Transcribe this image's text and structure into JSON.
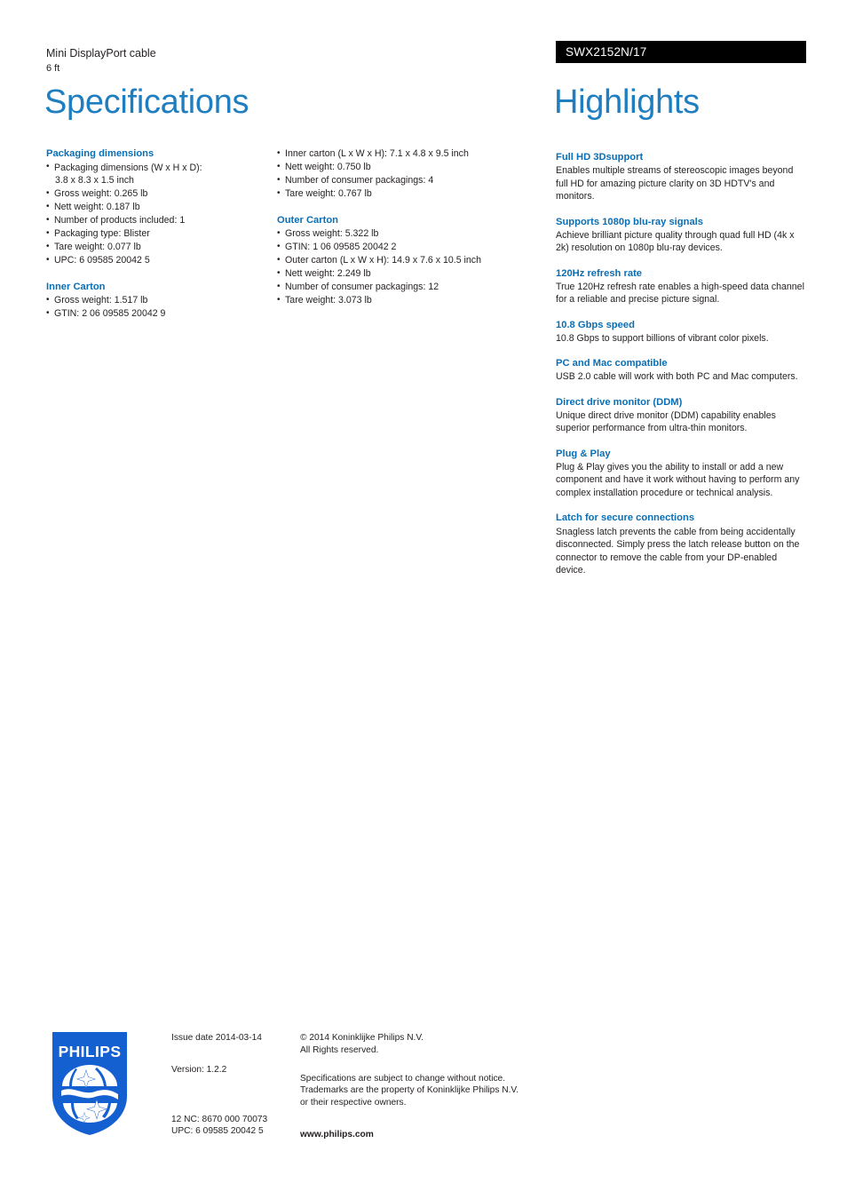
{
  "header": {
    "product_name": "Mini DisplayPort cable",
    "product_length": "6 ft",
    "product_code": "SWX2152N/17",
    "title_left": "Specifications",
    "title_right": "Highlights"
  },
  "colors": {
    "heading_blue": "#0a6eb4",
    "title_blue": "#1f7ec0",
    "code_bar_bg": "#000000",
    "logo_blue": "#1560d0",
    "body_text": "#231f20"
  },
  "spec_col_1": [
    {
      "heading": "Packaging dimensions",
      "items": [
        "Packaging dimensions (W x H x D):",
        "Gross weight: 0.265 lb",
        "Nett weight: 0.187 lb",
        "Number of products included: 1",
        "Packaging type: Blister",
        "Tare weight: 0.077 lb",
        "UPC: 6 09585 20042 5"
      ],
      "item0_continuation": "3.8 x 8.3 x 1.5 inch"
    },
    {
      "heading": "Inner Carton",
      "items": [
        "Gross weight: 1.517 lb",
        "GTIN: 2 06 09585 20042 9"
      ]
    }
  ],
  "spec_col_2": [
    {
      "heading": "",
      "items": [
        "Inner carton (L x W x H): 7.1 x 4.8 x 9.5 inch",
        "Nett weight: 0.750 lb",
        "Number of consumer packagings: 4",
        "Tare weight: 0.767 lb"
      ]
    },
    {
      "heading": "Outer Carton",
      "items": [
        "Gross weight: 5.322 lb",
        "GTIN: 1 06 09585 20042 2",
        "Outer carton (L x W x H): 14.9 x 7.6 x 10.5 inch",
        "Nett weight: 2.249 lb",
        "Number of consumer packagings: 12",
        "Tare weight: 3.073 lb"
      ]
    }
  ],
  "highlights": [
    {
      "title": "Full HD 3Dsupport",
      "body": "Enables multiple streams of stereoscopic images beyond full HD for amazing picture clarity on 3D HDTV's and monitors."
    },
    {
      "title": "Supports 1080p blu-ray signals",
      "body": "Achieve brilliant picture quality through quad full HD (4k x 2k) resolution on 1080p blu-ray devices."
    },
    {
      "title": "120Hz refresh rate",
      "body": "True 120Hz refresh rate enables a high-speed data channel for a reliable and precise picture signal."
    },
    {
      "title": "10.8 Gbps speed",
      "body": "10.8 Gbps to support billions of vibrant color pixels."
    },
    {
      "title": "PC and Mac compatible",
      "body": "USB 2.0 cable will work with both PC and Mac computers."
    },
    {
      "title": "Direct drive monitor (DDM)",
      "body": "Unique direct drive monitor (DDM) capability enables superior performance from ultra-thin monitors."
    },
    {
      "title": "Plug & Play",
      "body": "Plug & Play gives you the ability to install or add a new component and have it work without having to perform any complex installation procedure or technical analysis."
    },
    {
      "title": "Latch for secure connections",
      "body": "Snagless latch prevents the cable from being accidentally disconnected. Simply press the latch release button on the connector to remove the cable from your DP-enabled device."
    }
  ],
  "footer": {
    "logo_wordmark": "PHILIPS",
    "issue_date": "Issue date 2014-03-14",
    "version": "Version: 1.2.2",
    "twelve_nc": "12 NC: 8670 000 70073",
    "upc": "UPC: 6 09585 20042 5",
    "copyright_line1": "© 2014 Koninklijke Philips N.V.",
    "copyright_line2": "All Rights reserved.",
    "disclaimer_line1": "Specifications are subject to change without notice.",
    "disclaimer_line2": "Trademarks are the property of Koninklijke Philips N.V.",
    "disclaimer_line3": "or their respective owners.",
    "website": "www.philips.com"
  }
}
